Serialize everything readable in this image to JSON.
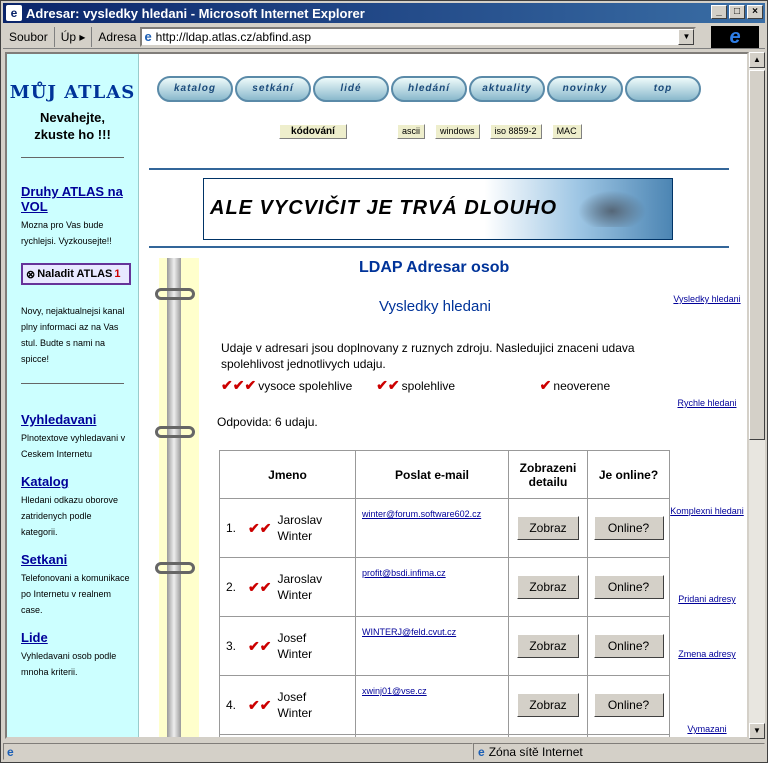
{
  "window": {
    "title": "Adresar: vysledky hledani - Microsoft Internet Explorer"
  },
  "toolbar": {
    "menu1": "Soubor",
    "menu2": "Úp",
    "address_label": "Adresa",
    "url": "http://ldap.atlas.cz/abfind.asp"
  },
  "status": {
    "zone": "Zóna sítě Internet"
  },
  "sidebar": {
    "logo": "MŮJ ATLAS",
    "slogan1": "Nevahejte,",
    "slogan2": "zkuste ho !!!",
    "druhy": {
      "link": "Druhy ATLAS na VOL",
      "text": "Mozna pro Vas bude rychlejsi. Vyzkousejte!!"
    },
    "naladit": {
      "label": "Naladit ATLAS",
      "num": "1"
    },
    "kanal": "Novy, nejaktualnejsi kanal plny informaci az na Vas stul. Budte s nami na spicce!",
    "items": [
      {
        "link": "Vyhledavani",
        "text": "Plnotextove vyhledavani v Ceskem Internetu"
      },
      {
        "link": "Katalog",
        "text": "Hledani odkazu oborove zatridenych podle kategorii."
      },
      {
        "link": "Setkani",
        "text": "Telefonovani a komunikace po Internetu v realnem case."
      },
      {
        "link": "Lide",
        "text": "Vyhledavani osob podle mnoha kriterii."
      }
    ]
  },
  "nav": [
    "katalog",
    "setkání",
    "lidé",
    "hledání",
    "aktuality",
    "novinky",
    "top"
  ],
  "encoding": {
    "label": "kódování",
    "options": [
      "ascii",
      "windows",
      "iso 8859-2",
      "MAC"
    ]
  },
  "banner": "ALE VYCVIČIT JE TRVÁ DLOUHO",
  "page": {
    "title": "LDAP Adresar osob",
    "subtitle": "Vysledky hledani",
    "intro": "Udaje v adresari jsou doplnovany z ruznych zdroju. Nasledujici znaceni udava spolehlivost jednotlivych udaju.",
    "legend": {
      "high": "vysoce spolehlive",
      "mid": "spolehlive",
      "low": "neoverene"
    },
    "count": "Odpovida: 6 udaju."
  },
  "table": {
    "headers": [
      "Jmeno",
      "Poslat e-mail",
      "Zobrazeni detailu",
      "Je online?"
    ],
    "rows": [
      {
        "num": "1.",
        "first": "Jaroslav",
        "last": "Winter",
        "email": "winter@forum.software602.cz",
        "detail": "Zobraz",
        "online": "Online?"
      },
      {
        "num": "2.",
        "first": "Jaroslav",
        "last": "Winter",
        "email": "profit@bsdi.infima.cz",
        "detail": "Zobraz",
        "online": "Online?"
      },
      {
        "num": "3.",
        "first": "Josef",
        "last": "Winter",
        "email": "WINTERJ@feld.cvut.cz",
        "detail": "Zobraz",
        "online": "Online?"
      },
      {
        "num": "4.",
        "first": "Josef",
        "last": "Winter",
        "email": "xwinj01@vse.cz",
        "detail": "Zobraz",
        "online": "Online?"
      }
    ]
  },
  "right_links": [
    "Vysledky hledani",
    "Rychle hledani",
    "Komplexni hledani",
    "Pridani adresy",
    "Zmena adresy",
    "Vymazani"
  ]
}
